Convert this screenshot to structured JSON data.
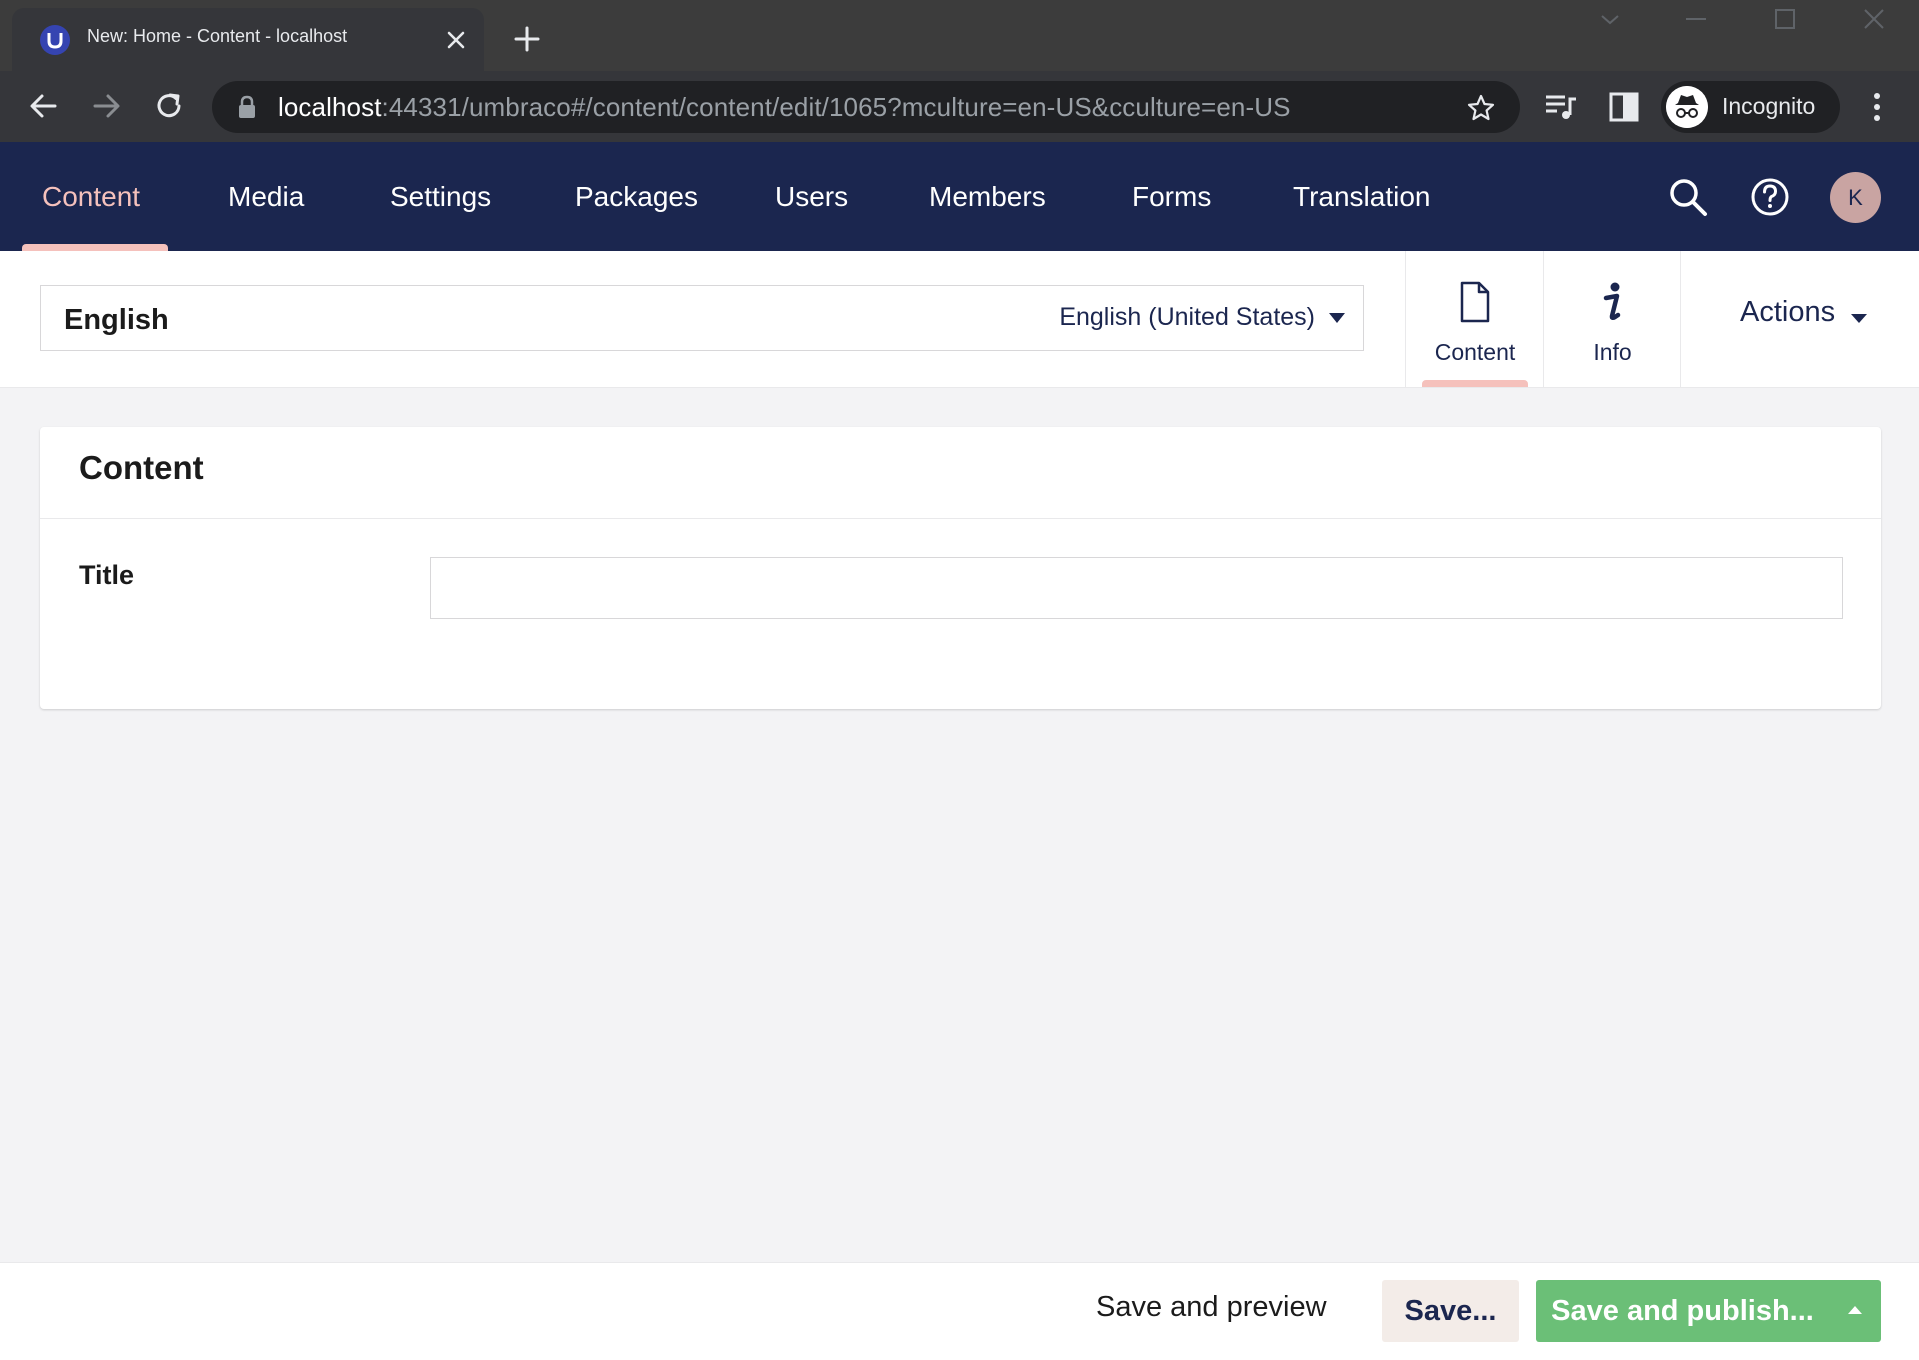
{
  "browser": {
    "tab_title": "New: Home - Content - localhost",
    "url_host": "localhost",
    "url_rest": ":44331/umbraco#/content/content/edit/1065?mculture=en-US&cculture=en-US",
    "profile_label": "Incognito"
  },
  "header": {
    "sections": [
      {
        "label": "Content",
        "active": true
      },
      {
        "label": "Media"
      },
      {
        "label": "Settings"
      },
      {
        "label": "Packages"
      },
      {
        "label": "Users"
      },
      {
        "label": "Members"
      },
      {
        "label": "Forms"
      },
      {
        "label": "Translation"
      }
    ],
    "avatar_initial": "K",
    "active_color": "#f5c1bc",
    "background_color": "#1b264f"
  },
  "editor": {
    "name_value": "English",
    "culture_label": "English (United States)",
    "apps": [
      {
        "label": "Content",
        "icon": "document-icon",
        "active": true
      },
      {
        "label": "Info",
        "icon": "info-icon"
      }
    ],
    "actions_label": "Actions"
  },
  "panel": {
    "title": "Content",
    "properties": [
      {
        "label": "Title",
        "value": ""
      }
    ]
  },
  "footer": {
    "save_preview_label": "Save and preview",
    "save_label": "Save...",
    "publish_label": "Save and publish...",
    "publish_color": "#6bbf77"
  }
}
